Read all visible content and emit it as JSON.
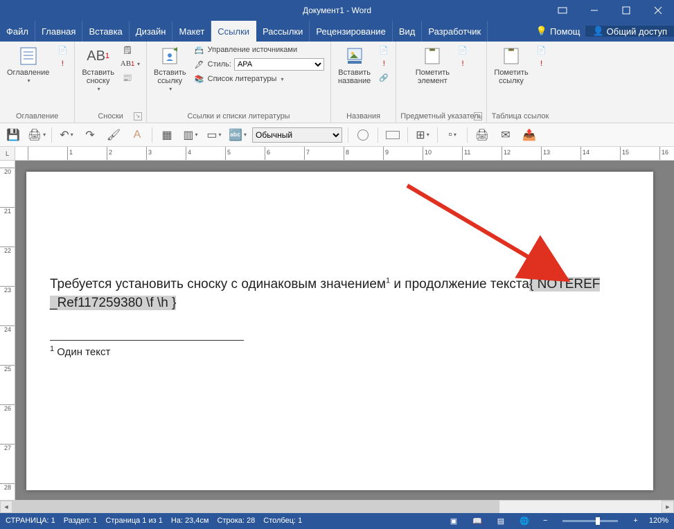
{
  "title": "Документ1 - Word",
  "tabs": {
    "file": "Файл",
    "home": "Главная",
    "insert": "Вставка",
    "design": "Дизайн",
    "layout": "Макет",
    "references": "Ссылки",
    "mailings": "Рассылки",
    "review": "Рецензирование",
    "view": "Вид",
    "developer": "Разработчик",
    "help": "Помощ",
    "share": "Общий доступ"
  },
  "ribbon": {
    "toc": {
      "btn": "Оглавление",
      "group": "Оглавление"
    },
    "footnotes": {
      "insert": "Вставить\nсноску",
      "ab": "AB",
      "group": "Сноски"
    },
    "citations": {
      "insert": "Вставить\nссылку",
      "manage": "Управление источниками",
      "style_label": "Стиль:",
      "style_value": "APA",
      "biblio": "Список литературы",
      "group": "Ссылки и списки литературы"
    },
    "captions": {
      "insert": "Вставить\nназвание",
      "group": "Названия"
    },
    "index": {
      "mark": "Пометить\nэлемент",
      "group": "Предметный указатель"
    },
    "toa": {
      "mark": "Пометить\nссылку",
      "group": "Таблица ссылок"
    }
  },
  "qat": {
    "style_value": "Обычный"
  },
  "document": {
    "line1_a": "Требуется установить сноску с одинаковым значением",
    "line1_sup": "1",
    "line1_b": " и продолжение текста",
    "field_code": "{ NOTEREF _Ref117259380 \\f \\h }",
    "fn_num": "1",
    "fn_text": " Один текст"
  },
  "status": {
    "page": "СТРАНИЦА: 1",
    "section": "Раздел: 1",
    "pageof": "Страница 1 из 1",
    "at": "На: 23,4см",
    "line": "Строка: 28",
    "col": "Столбец: 1",
    "zoom": "120%"
  }
}
